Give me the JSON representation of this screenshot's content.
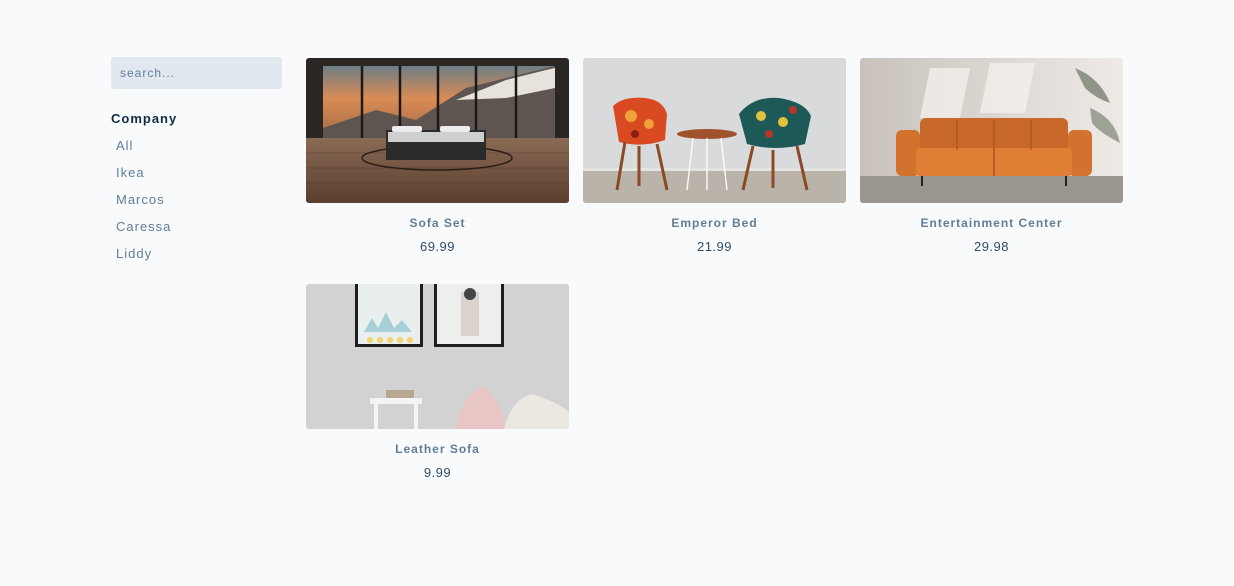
{
  "filters": {
    "search_placeholder": "search...",
    "company_heading": "Company",
    "companies": [
      "All",
      "Ikea",
      "Marcos",
      "Caressa",
      "Liddy"
    ]
  },
  "products": [
    {
      "name": "Sofa Set",
      "price": "69.99",
      "image": "bed-in-mountain-view-room"
    },
    {
      "name": "Emperor Bed",
      "price": "21.99",
      "image": "two-patterned-chairs-and-table"
    },
    {
      "name": "Entertainment Center",
      "price": "29.98",
      "image": "orange-leather-sofa"
    },
    {
      "name": "Leather Sofa",
      "price": "9.99",
      "image": "framed-pictures-and-cushions"
    }
  ],
  "colors": {
    "background": "#f8fafc",
    "search_bg": "#e2e8f0",
    "heading": "#102a42",
    "muted_text": "#617d98",
    "price_text": "#324d67"
  }
}
